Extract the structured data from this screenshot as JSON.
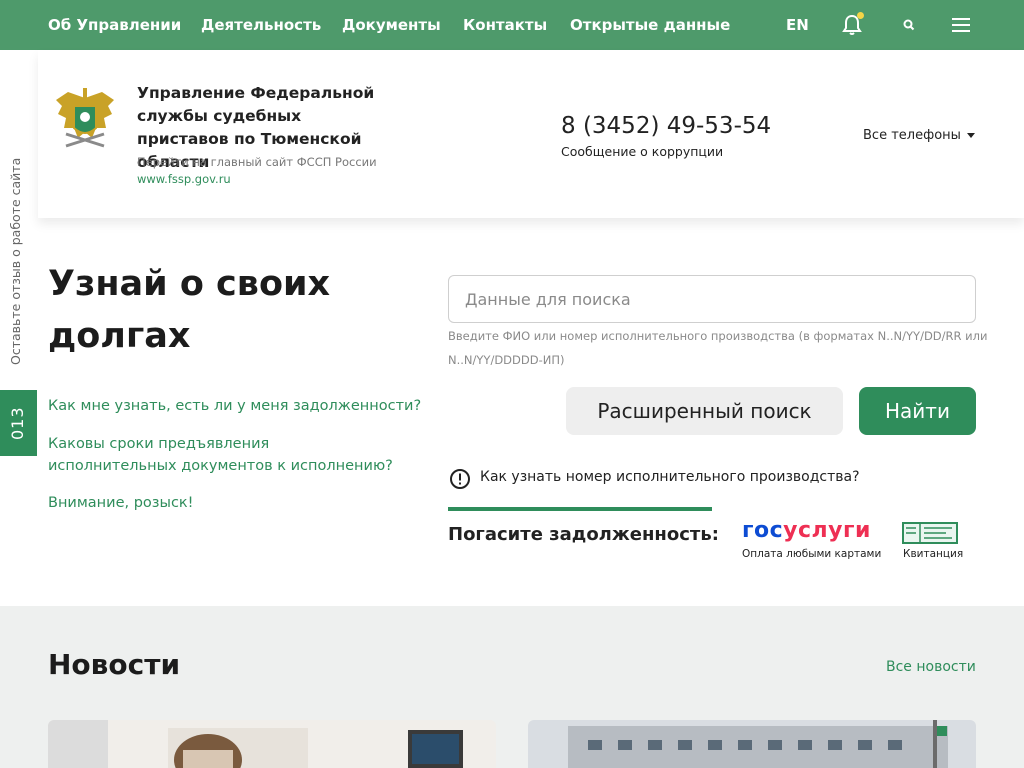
{
  "nav": {
    "items": [
      "Об Управлении",
      "Деятельность",
      "Документы",
      "Контакты",
      "Открытые данные"
    ],
    "lang": "EN"
  },
  "header": {
    "title": "Управление Федеральной службы судебных приставов по Тюменской области",
    "link_label": "Перейти на главный сайт ФССП России",
    "link": "www.fssp.gov.ru",
    "phone": "8 (3452) 49-53-54",
    "phone_note": "Сообщение о коррупции",
    "all_phones": "Все телефоны"
  },
  "sidebar": {
    "feedback": "Оставьте отзыв о работе сайта",
    "counter": "013"
  },
  "hero": {
    "title": "Узнай о своих долгах",
    "faq": [
      "Как мне узнать, есть ли у меня задолженности?",
      "Каковы сроки предъявления исполнительных документов к исполнению?",
      "Внимание, розыск!"
    ],
    "search_placeholder": "Данные для поиска",
    "search_value": "",
    "search_hint": "Введите ФИО или номер исполнительного производства (в форматах N..N/YY/DD/RR или N..N/YY/DDDDD-ИП)",
    "btn_advanced": "Расширенный поиск",
    "btn_find": "Найти",
    "info": "Как узнать номер исполнительного производства?",
    "pay_label": "Погасите задолженность:",
    "gos_part1": "гос",
    "gos_part2": "услуги",
    "gos_sub": "Оплата любыми картами",
    "kv_sub": "Квитанция"
  },
  "news": {
    "title": "Новости",
    "all": "Все новости"
  },
  "colors": {
    "nav_bg": "#4e9a6b",
    "accent": "#2f8d5b",
    "gos_blue": "#0d4cd3",
    "gos_red": "#ee2f53"
  },
  "icons": [
    "bell-icon",
    "search-icon",
    "menu-icon",
    "emblem-icon",
    "info-icon",
    "receipt-icon"
  ]
}
